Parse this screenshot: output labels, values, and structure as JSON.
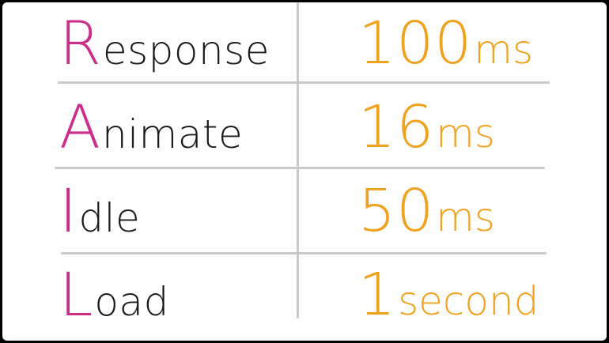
{
  "table": {
    "rows": [
      {
        "initial": "R",
        "rest": "esponse",
        "num": "100",
        "unit": "ms"
      },
      {
        "initial": "A",
        "rest": "nimate",
        "num": "16",
        "unit": "ms"
      },
      {
        "initial": "I",
        "rest": "dle",
        "num": "50",
        "unit": "ms"
      },
      {
        "initial": "L",
        "rest": "oad",
        "num": "1",
        "unit": " second"
      }
    ]
  },
  "colors": {
    "initial": "#cc2d8a",
    "value": "#f0a21e",
    "text": "#1a1a1a",
    "lines": "#c9c9c9"
  }
}
